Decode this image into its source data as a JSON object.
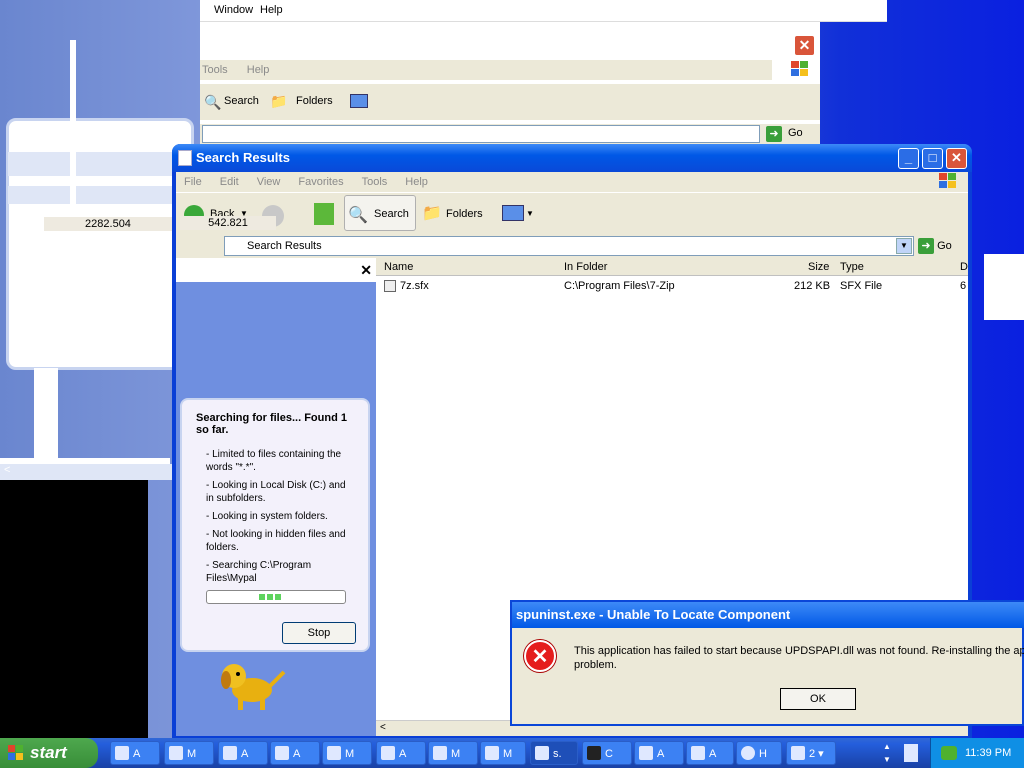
{
  "background_window": {
    "top_menu": [
      "Window",
      "Help"
    ],
    "menu": [
      "Tools",
      "Help"
    ],
    "toolbar": {
      "search": "Search",
      "folders": "Folders"
    },
    "go": "Go"
  },
  "ghost": {
    "value1": "2282.504",
    "value2": "542.821"
  },
  "window": {
    "title": "Search Results",
    "menu": [
      "File",
      "Edit",
      "View",
      "Favorites",
      "Tools",
      "Help"
    ],
    "toolbar": {
      "back": "Back",
      "search": "Search",
      "folders": "Folders"
    },
    "address": "Search Results",
    "go": "Go"
  },
  "search_pane": {
    "heading": "Searching for files...  Found 1 so far.",
    "items": [
      "- Limited to files containing the words \"*.*\".",
      "- Looking in Local Disk (C:) and in subfolders.",
      "- Looking in system folders.",
      "- Not looking in hidden files and folders.",
      "- Searching C:\\Program Files\\Mypal"
    ],
    "stop": "Stop"
  },
  "results": {
    "columns": [
      "Name",
      "In Folder",
      "Size",
      "Type",
      "D"
    ],
    "rows": [
      {
        "name": "7z.sfx",
        "folder": "C:\\Program Files\\7-Zip",
        "size": "212 KB",
        "type": "SFX File",
        "d": "6"
      }
    ]
  },
  "dialog": {
    "title": "spuninst.exe - Unable To Locate Component",
    "message_line1": "This application has failed to start because UPDSPAPI.dll was not found. Re-installing the appl",
    "message_line2": "problem.",
    "ok": "OK"
  },
  "taskbar": {
    "start": "start",
    "tasks": [
      "A",
      "M",
      "A",
      "A",
      "M",
      "A",
      "M",
      "M",
      "s.",
      "C",
      "A",
      "A",
      "H",
      "2"
    ],
    "clock": "11:39 PM"
  },
  "colors": {
    "xp_blue": "#0058e6",
    "start_green": "#388e38",
    "error_red": "#e51d1d"
  }
}
